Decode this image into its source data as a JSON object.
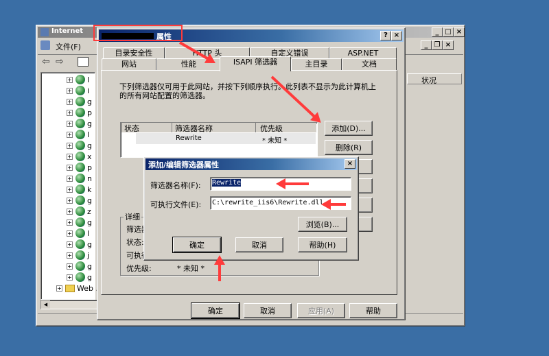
{
  "iis_window": {
    "title": "Internet",
    "menu_file": "文件(F)",
    "tree_items": [
      "l",
      "i",
      "g",
      "p",
      "g",
      "l",
      "g",
      "x",
      "p",
      "n",
      "k",
      "g",
      "z",
      "g",
      "l",
      "g",
      "j",
      "g",
      "g"
    ],
    "web_node": "Web .",
    "right_header": "状况"
  },
  "properties_dialog": {
    "title_suffix": "属性",
    "tabs_row1": [
      "目录安全性",
      "HTTP 头",
      "自定义错误",
      "ASP.NET"
    ],
    "tabs_row2": [
      "网站",
      "性能",
      "ISAPI 筛选器",
      "主目录",
      "文档"
    ],
    "active_tab": "ISAPI 筛选器",
    "description": "下列筛选器仅可用于此网站，并按下列顺序执行。此列表不显示为此计算机上的所有网站配置的筛选器。",
    "columns": [
      "状态",
      "筛选器名称",
      "优先级"
    ],
    "rows": [
      {
        "status": "",
        "name": "Rewrite",
        "priority": "* 未知 *"
      }
    ],
    "add_button": "添加(D)...",
    "delete_button": "删除(R)",
    "details_label": "详细",
    "detail_name_label": "筛选器",
    "detail_status_label": "状态:",
    "detail_exec_label": "可执行",
    "detail_priority_label": "优先级:",
    "detail_priority_value": "* 未知 *",
    "ok_button": "确定",
    "cancel_button": "取消",
    "apply_button": "应用(A)",
    "help_button": "帮助"
  },
  "edit_dialog": {
    "title": "添加/编辑筛选器属性",
    "filter_name_label": "筛选器名称(F):",
    "filter_name_value": "Rewrite",
    "exec_label": "可执行文件(E):",
    "exec_value": "C:\\rewrite_iis6\\Rewrite.dll",
    "browse_button": "浏览(B)...",
    "ok_button": "确定",
    "cancel_button": "取消",
    "help_button": "帮助(H)"
  },
  "colors": {
    "desktop": "#3a6ea5",
    "annotation": "#ff3b3b",
    "title_active": "#0a246a"
  }
}
